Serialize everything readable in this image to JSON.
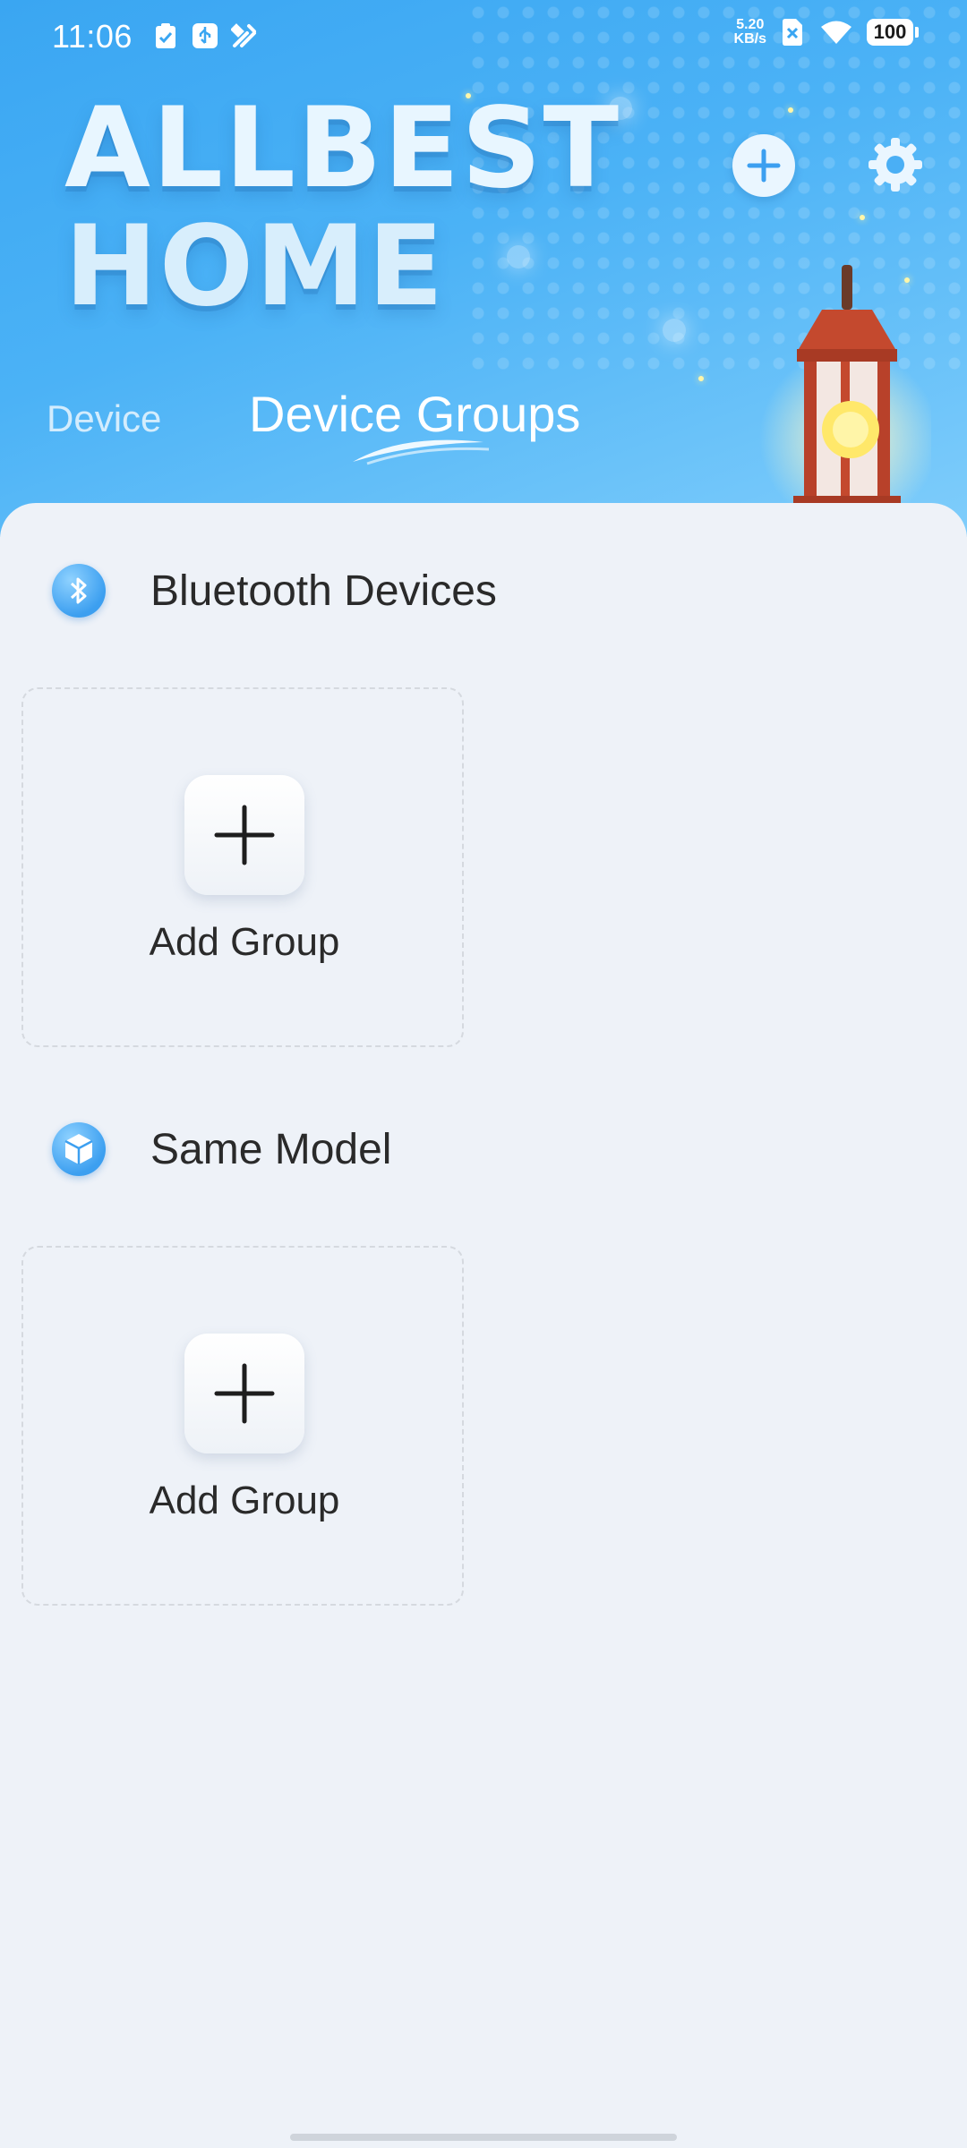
{
  "status_bar": {
    "time": "11:06",
    "net_speed_value": "5.20",
    "net_speed_unit": "KB/s",
    "battery": "100",
    "icons": [
      "clipboard-check-icon",
      "usb-debug-icon",
      "tools-icon",
      "sim-x-icon",
      "wifi-icon",
      "battery-icon"
    ]
  },
  "header": {
    "brand_line1": "ALLBEST",
    "brand_line2": "HOME",
    "add_icon": "plus-circle-icon",
    "settings_icon": "gear-icon"
  },
  "tabs": [
    {
      "label": "Device",
      "active": false
    },
    {
      "label": "Device Groups",
      "active": true
    }
  ],
  "sections": [
    {
      "title": "Bluetooth Devices",
      "icon": "bluetooth-icon",
      "card_label": "Add Group"
    },
    {
      "title": "Same Model",
      "icon": "cube-icon",
      "card_label": "Add Group"
    }
  ],
  "colors": {
    "header_blue": "#3aa6f2",
    "background": "#eef2f8",
    "text": "#2a2a2a",
    "accent": "#3c9ff0"
  }
}
